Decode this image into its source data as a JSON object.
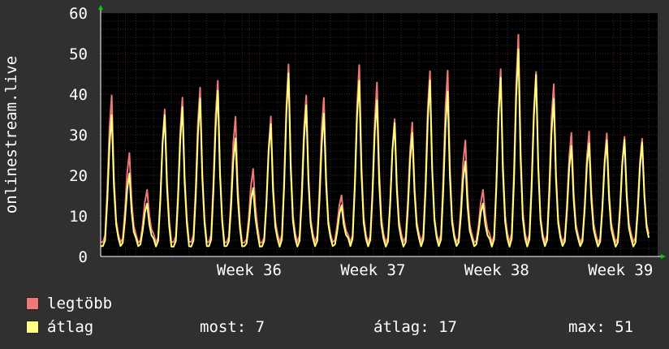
{
  "colors": {
    "background": "#303030",
    "plot_background": "#000000",
    "grid_minor": "#2b2b2b",
    "grid_major": "#5a2020",
    "axis_arrow": "#00cc00",
    "series_max": "#f07878",
    "series_avg": "#ffff80"
  },
  "legend": {
    "max_label": "legtöbb",
    "avg_label": "átlag"
  },
  "stats": {
    "now": "most: 7",
    "avg": "átlag: 17",
    "max": "max: 51"
  },
  "chart_data": {
    "type": "line",
    "title": "",
    "xlabel": "",
    "ylabel": "onlinestream.live",
    "xlim": [
      0,
      4.5
    ],
    "ylim": [
      0,
      60
    ],
    "yticks": [
      0,
      10,
      20,
      30,
      40,
      50,
      60
    ],
    "xticks": [
      {
        "label": "Week 36",
        "x": 1.2
      },
      {
        "label": "Week 37",
        "x": 2.2
      },
      {
        "label": "Week 38",
        "x": 3.2
      },
      {
        "label": "Week 39",
        "x": 4.2
      }
    ],
    "grid": true,
    "legend": "bottom-left",
    "day_peaks": {
      "avg": [
        36,
        21,
        13,
        34,
        36,
        39,
        42,
        30,
        17,
        32,
        44,
        37,
        36,
        13,
        44,
        38,
        32,
        30,
        44,
        42,
        24,
        13,
        43,
        50,
        45,
        40,
        28
      ],
      "max": [
        40,
        25,
        16,
        36,
        40,
        43,
        44,
        34,
        21,
        34,
        48,
        41,
        40,
        15,
        46,
        42,
        34,
        34,
        47,
        46,
        28,
        16,
        46,
        56,
        47,
        43,
        30
      ]
    },
    "series": [
      {
        "name": "legtöbb",
        "key": "max",
        "color": "#f07878"
      },
      {
        "name": "átlag",
        "key": "avg",
        "color": "#ffff80"
      }
    ]
  }
}
